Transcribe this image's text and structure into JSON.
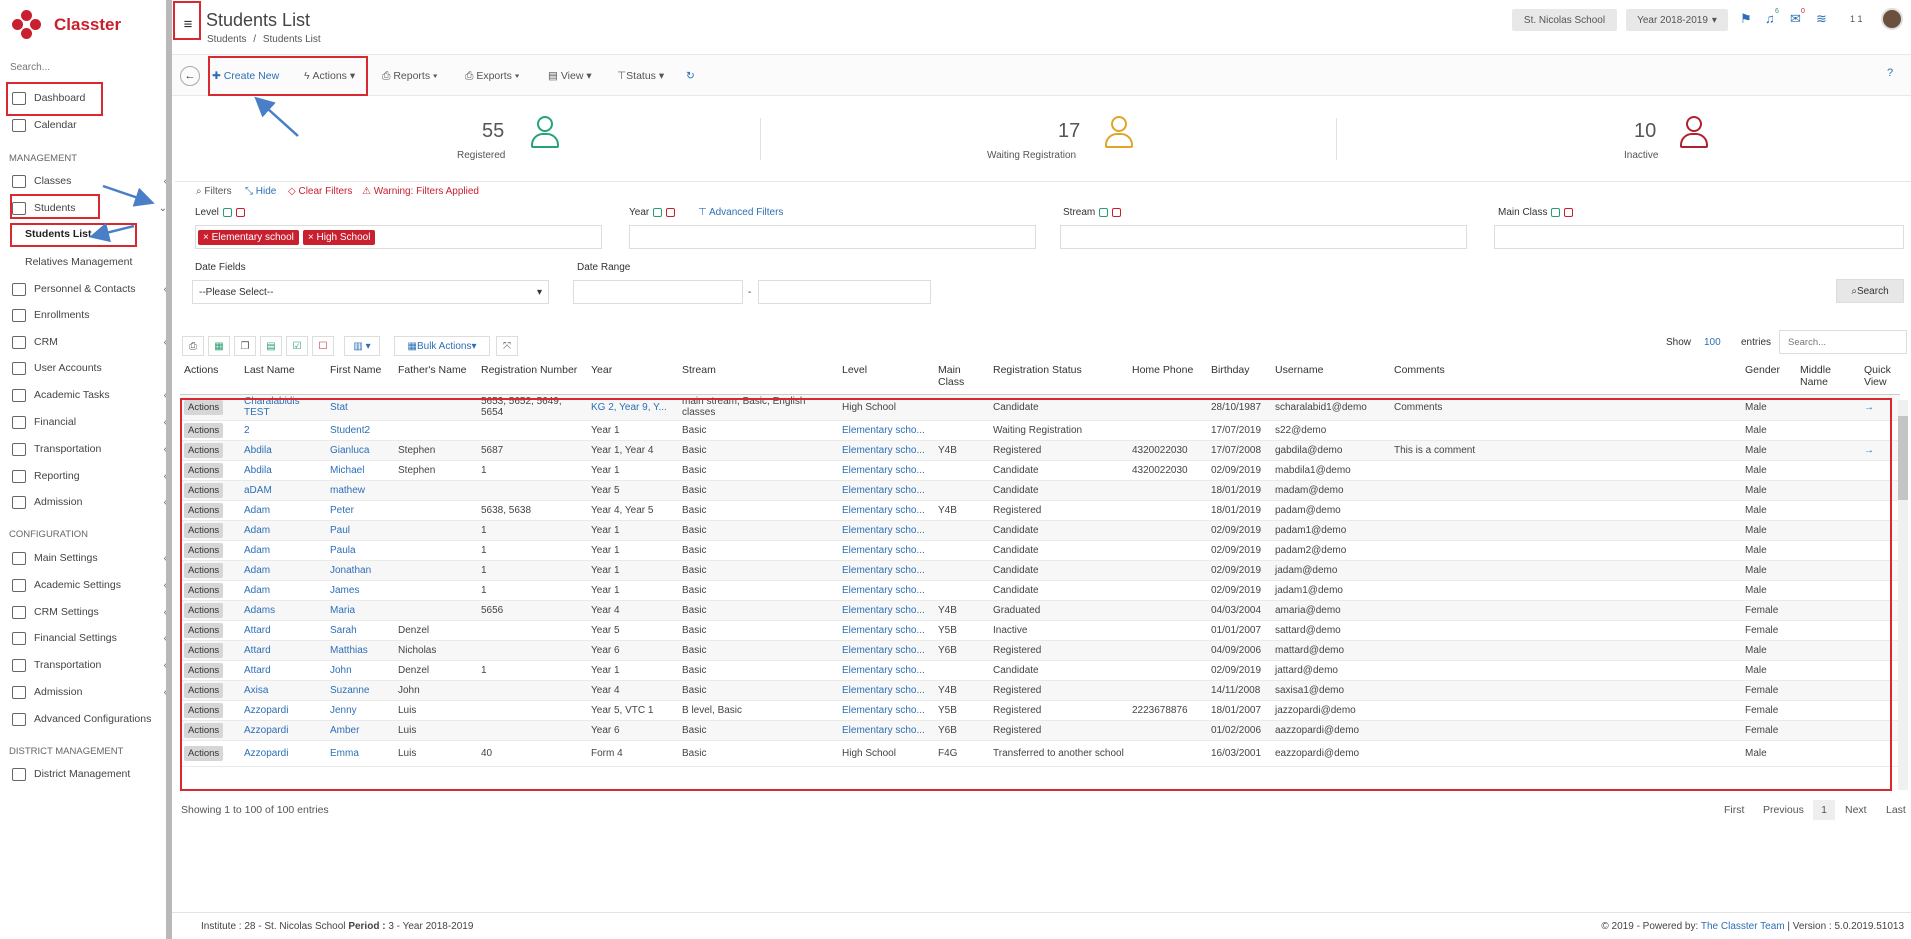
{
  "app": {
    "name": "Classter",
    "search_label": "Search..."
  },
  "sidebar": {
    "items": [
      {
        "label": "Dashboard"
      },
      {
        "label": "Calendar"
      }
    ],
    "management_heading": "MANAGEMENT",
    "management": [
      {
        "label": "Classes"
      },
      {
        "label": "Students"
      },
      {
        "label": "Students List"
      },
      {
        "label": "Relatives Management"
      },
      {
        "label": "Personnel & Contacts"
      },
      {
        "label": "Enrollments"
      },
      {
        "label": "CRM"
      },
      {
        "label": "User Accounts"
      },
      {
        "label": "Academic Tasks"
      },
      {
        "label": "Financial"
      },
      {
        "label": "Transportation"
      },
      {
        "label": "Reporting"
      },
      {
        "label": "Admission"
      }
    ],
    "configuration_heading": "CONFIGURATION",
    "configuration": [
      {
        "label": "Main Settings"
      },
      {
        "label": "Academic Settings"
      },
      {
        "label": "CRM Settings"
      },
      {
        "label": "Financial Settings"
      },
      {
        "label": "Transportation"
      },
      {
        "label": "Admission"
      },
      {
        "label": "Advanced Configurations"
      }
    ],
    "district_heading": "DISTRICT MANAGEMENT",
    "district": [
      {
        "label": "District Management"
      }
    ]
  },
  "header": {
    "title": "Students List",
    "breadcrumb": [
      "Students",
      "/",
      "Students List"
    ],
    "school": "St. Nicolas School",
    "year": "Year 2018-2019",
    "badge_bell": "6",
    "badge_mail": "0",
    "user_count": "1 1"
  },
  "toolbar": {
    "create_new": "Create New",
    "actions": "Actions",
    "reports": "Reports",
    "exports": "Exports",
    "view": "View",
    "status": "Status",
    "help": "?"
  },
  "stats": [
    {
      "value": "55",
      "label": "Registered",
      "color": "#26a27a"
    },
    {
      "value": "17",
      "label": "Waiting Registration",
      "color": "#e0a526"
    },
    {
      "value": "10",
      "label": "Inactive",
      "color": "#b0212e"
    }
  ],
  "filters": {
    "filters_label": "Filters",
    "hide_label": "Hide",
    "clear_label": "Clear Filters",
    "warning_label": "Warning: Filters Applied",
    "level_label": "Level",
    "level_chips": [
      "Elementary school",
      "High School"
    ],
    "year_label": "Year",
    "advanced_label": "Advanced Filters",
    "stream_label": "Stream",
    "main_class_label": "Main Class",
    "date_fields_label": "Date Fields",
    "date_fields_value": "--Please Select--",
    "date_range_label": "Date Range",
    "date_range_sep": "-",
    "search_button": "Search"
  },
  "table_controls": {
    "bulk_actions": "Bulk Actions",
    "show_label": "Show",
    "show_value": "100",
    "entries_label": "entries",
    "search_placeholder": "Search..."
  },
  "table": {
    "columns": [
      "Actions",
      "Last Name",
      "First Name",
      "Father's Name",
      "Registration Number",
      "Year",
      "Stream",
      "Level",
      "Main Class",
      "Registration Status",
      "Home Phone",
      "Birthday",
      "Username",
      "Comments",
      "Gender",
      "Middle Name",
      "Quick View"
    ],
    "rows": [
      [
        "Actions",
        "Charalabidis TEST",
        "Stat",
        "",
        "5653, 5652, 5649, 5654",
        "KG 2, Year 9, Y...",
        "main stream, Basic, English classes",
        "High School",
        "",
        "Candidate",
        "",
        "28/10/1987",
        "scharalabid1@demo",
        "Comments",
        "Male",
        "",
        "→"
      ],
      [
        "Actions",
        "2",
        "Student2",
        "",
        "",
        "Year 1",
        "Basic",
        "Elementary scho...",
        "",
        "Waiting Registration",
        "",
        "17/07/2019",
        "s22@demo",
        "",
        "Male",
        "",
        ""
      ],
      [
        "Actions",
        "Abdila",
        "Gianluca",
        "Stephen",
        "5687",
        "Year 1, Year 4",
        "Basic",
        "Elementary scho...",
        "Y4B",
        "Registered",
        "4320022030",
        "17/07/2008",
        "gabdila@demo",
        "This is a comment",
        "Male",
        "",
        "→"
      ],
      [
        "Actions",
        "Abdila",
        "Michael",
        "Stephen",
        "1",
        "Year 1",
        "Basic",
        "Elementary scho...",
        "",
        "Candidate",
        "4320022030",
        "02/09/2019",
        "mabdila1@demo",
        "",
        "Male",
        "",
        ""
      ],
      [
        "Actions",
        "aDAM",
        "mathew",
        "",
        "",
        "Year 5",
        "Basic",
        "Elementary scho...",
        "",
        "Candidate",
        "",
        "18/01/2019",
        "madam@demo",
        "",
        "Male",
        "",
        ""
      ],
      [
        "Actions",
        "Adam",
        "Peter",
        "",
        "5638, 5638",
        "Year 4, Year 5",
        "Basic",
        "Elementary scho...",
        "Y4B",
        "Registered",
        "",
        "18/01/2019",
        "padam@demo",
        "",
        "Male",
        "",
        ""
      ],
      [
        "Actions",
        "Adam",
        "Paul",
        "",
        "1",
        "Year 1",
        "Basic",
        "Elementary scho...",
        "",
        "Candidate",
        "",
        "02/09/2019",
        "padam1@demo",
        "",
        "Male",
        "",
        ""
      ],
      [
        "Actions",
        "Adam",
        "Paula",
        "",
        "1",
        "Year 1",
        "Basic",
        "Elementary scho...",
        "",
        "Candidate",
        "",
        "02/09/2019",
        "padam2@demo",
        "",
        "Male",
        "",
        ""
      ],
      [
        "Actions",
        "Adam",
        "Jonathan",
        "",
        "1",
        "Year 1",
        "Basic",
        "Elementary scho...",
        "",
        "Candidate",
        "",
        "02/09/2019",
        "jadam@demo",
        "",
        "Male",
        "",
        ""
      ],
      [
        "Actions",
        "Adam",
        "James",
        "",
        "1",
        "Year 1",
        "Basic",
        "Elementary scho...",
        "",
        "Candidate",
        "",
        "02/09/2019",
        "jadam1@demo",
        "",
        "Male",
        "",
        ""
      ],
      [
        "Actions",
        "Adams",
        "Maria",
        "",
        "5656",
        "Year 4",
        "Basic",
        "Elementary scho...",
        "Y4B",
        "Graduated",
        "",
        "04/03/2004",
        "amaria@demo",
        "",
        "Female",
        "",
        ""
      ],
      [
        "Actions",
        "Attard",
        "Sarah",
        "Denzel",
        "",
        "Year 5",
        "Basic",
        "Elementary scho...",
        "Y5B",
        "Inactive",
        "",
        "01/01/2007",
        "sattard@demo",
        "",
        "Female",
        "",
        ""
      ],
      [
        "Actions",
        "Attard",
        "Matthias",
        "Nicholas",
        "",
        "Year 6",
        "Basic",
        "Elementary scho...",
        "Y6B",
        "Registered",
        "",
        "04/09/2006",
        "mattard@demo",
        "",
        "Male",
        "",
        ""
      ],
      [
        "Actions",
        "Attard",
        "John",
        "Denzel",
        "1",
        "Year 1",
        "Basic",
        "Elementary scho...",
        "",
        "Candidate",
        "",
        "02/09/2019",
        "jattard@demo",
        "",
        "Male",
        "",
        ""
      ],
      [
        "Actions",
        "Axisa",
        "Suzanne",
        "John",
        "",
        "Year 4",
        "Basic",
        "Elementary scho...",
        "Y4B",
        "Registered",
        "",
        "14/11/2008",
        "saxisa1@demo",
        "",
        "Female",
        "",
        ""
      ],
      [
        "Actions",
        "Azzopardi",
        "Jenny",
        "Luis",
        "",
        "Year 5, VTC 1",
        "B level, Basic",
        "Elementary scho...",
        "Y5B",
        "Registered",
        "2223678876",
        "18/01/2007",
        "jazzopardi@demo",
        "",
        "Female",
        "",
        ""
      ],
      [
        "Actions",
        "Azzopardi",
        "Amber",
        "Luis",
        "",
        "Year 6",
        "Basic",
        "Elementary scho...",
        "Y6B",
        "Registered",
        "",
        "01/02/2006",
        "aazzopardi@demo",
        "",
        "Female",
        "",
        ""
      ],
      [
        "Actions",
        "Azzopardi",
        "Emma",
        "Luis",
        "40",
        "Form 4",
        "Basic",
        "High School",
        "F4G",
        "Transferred to another school",
        "",
        "16/03/2001",
        "eazzopardi@demo",
        "",
        "Male",
        "",
        ""
      ]
    ]
  },
  "pagination": {
    "info": "Showing 1 to 100 of 100 entries",
    "first": "First",
    "previous": "Previous",
    "current": "1",
    "next": "Next",
    "last": "Last"
  },
  "footer": {
    "institute_label": "Institute :",
    "institute_value": "28 - St. Nicolas School",
    "period_label": "Period :",
    "period_value": "3 - Year 2018-2019",
    "copyright": "© 2019 - Powered by:",
    "team": "The Classter Team",
    "version": "| Version : 5.0.2019.51013"
  },
  "icons": [
    "menu-icon",
    "back-icon",
    "plus-icon",
    "bolt-icon",
    "print-icon",
    "view-icon",
    "filter-icon",
    "refresh-icon",
    "help-icon",
    "flag-icon",
    "bell-icon",
    "mail-icon",
    "layers-icon",
    "avatar",
    "person-icon"
  ]
}
